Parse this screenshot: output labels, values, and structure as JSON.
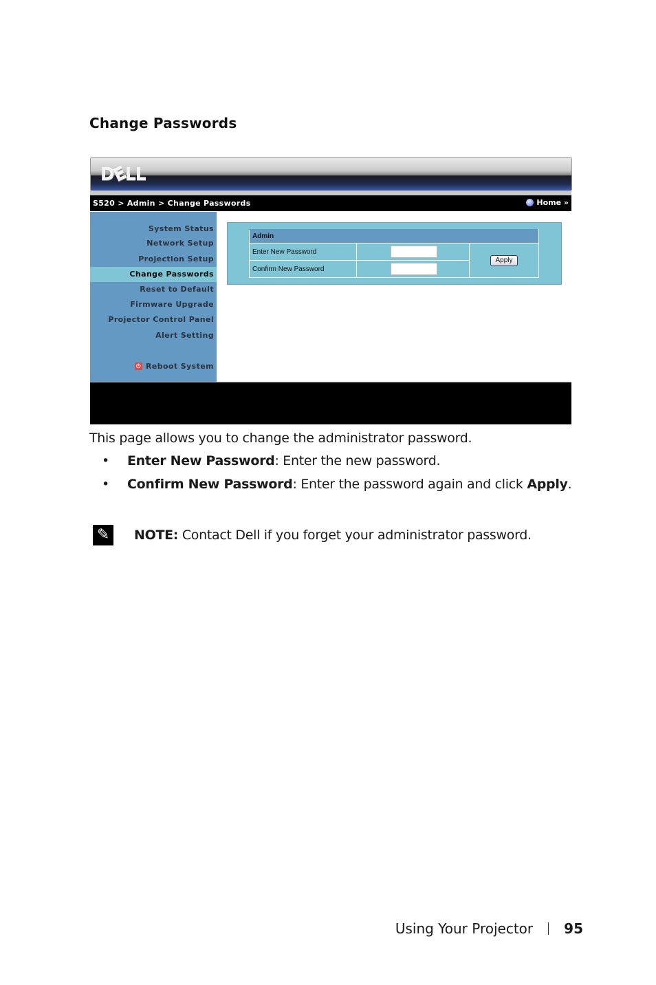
{
  "section_title": "Change Passwords",
  "screenshot": {
    "logo_text": [
      "D",
      "E",
      "LL"
    ],
    "breadcrumb": "S520 > Admin > Change Passwords",
    "home_link": "Home »",
    "sidebar": {
      "items": [
        {
          "label": "System Status",
          "active": false
        },
        {
          "label": "Network Setup",
          "active": false
        },
        {
          "label": "Projection Setup",
          "active": false
        },
        {
          "label": "Change Passwords",
          "active": true
        },
        {
          "label": "Reset to Default",
          "active": false
        },
        {
          "label": "Firmware Upgrade",
          "active": false
        },
        {
          "label": "Projector Control Panel",
          "active": false
        },
        {
          "label": "Alert Setting",
          "active": false
        }
      ],
      "reboot_label": "Reboot System",
      "reboot_icon": "power-icon"
    },
    "form": {
      "header": "Admin",
      "fields": [
        {
          "label": "Enter New Password",
          "value": ""
        },
        {
          "label": "Confirm New Password",
          "value": ""
        }
      ],
      "apply_label": "Apply"
    },
    "colors": {
      "sidebar": "#6399c2",
      "active_item": "#80c5d6",
      "panel": "#80c5d6",
      "bars": "#000000"
    }
  },
  "description": "This page allows you to change the administrator password.",
  "bullets": [
    {
      "term": "Enter New Password",
      "text": ": Enter the new password.",
      "tail_bold": "",
      "tail_end": ""
    },
    {
      "term": "Confirm New Password",
      "text": ": Enter the password again and click ",
      "tail_bold": "Apply",
      "tail_end": "."
    }
  ],
  "note": {
    "icon": "pencil-note-icon",
    "label": "NOTE:",
    "text": " Contact Dell if you forget your administrator password."
  },
  "page_footer": {
    "chapter": "Using Your Projector",
    "page_number": "95"
  }
}
